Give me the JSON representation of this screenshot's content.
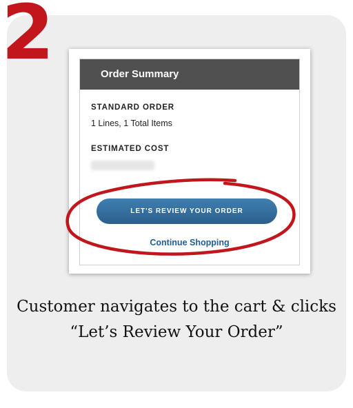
{
  "step": {
    "number": "2"
  },
  "order_summary": {
    "title": "Order Summary",
    "order_type_label": "STANDARD ORDER",
    "line_count_text": "1 Lines, 1 Total Items",
    "estimated_cost_label": "ESTIMATED COST",
    "review_button_label": "LET'S REVIEW YOUR ORDER",
    "continue_link_label": "Continue Shopping"
  },
  "caption": {
    "text": "Customer navigates to the cart & clicks “Let’s Review Your Order”"
  },
  "colors": {
    "accent_red": "#c0161c",
    "header_gray": "#505050",
    "button_blue": "#2f6a99",
    "link_blue": "#1f5d96",
    "card_bg": "#eeeeee"
  }
}
